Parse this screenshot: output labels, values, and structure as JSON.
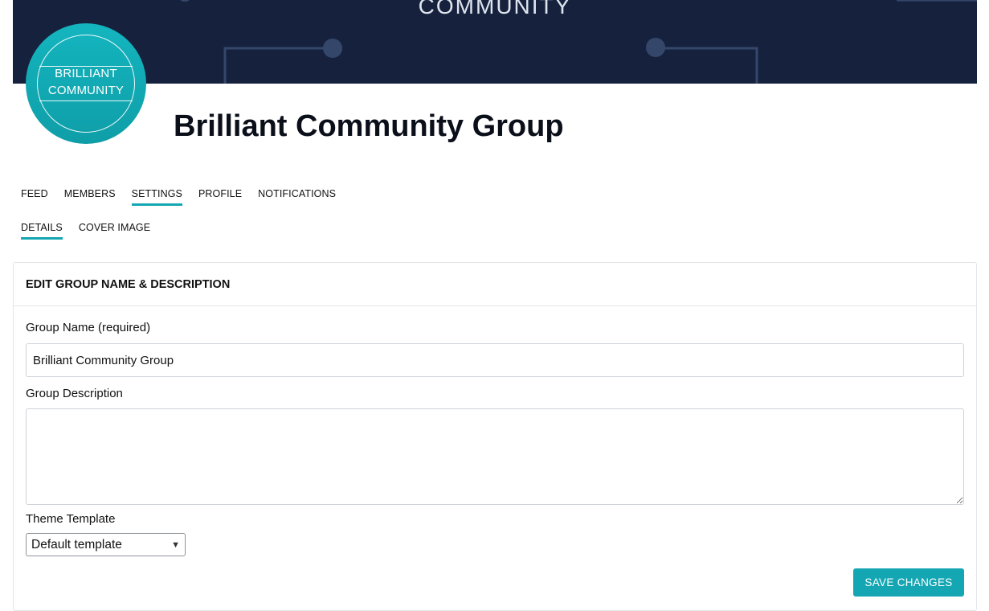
{
  "cover": {
    "text": "COMMUNITY",
    "background_color": "#16223d"
  },
  "avatar": {
    "line1": "BRILLIANT",
    "line2": "COMMUNITY",
    "color": "#14b5bf"
  },
  "group": {
    "title": "Brilliant Community Group"
  },
  "tabs": [
    {
      "label": "FEED",
      "active": false
    },
    {
      "label": "MEMBERS",
      "active": false
    },
    {
      "label": "SETTINGS",
      "active": true
    },
    {
      "label": "PROFILE",
      "active": false
    },
    {
      "label": "NOTIFICATIONS",
      "active": false
    }
  ],
  "subtabs": [
    {
      "label": "DETAILS",
      "active": true
    },
    {
      "label": "COVER IMAGE",
      "active": false
    }
  ],
  "panel": {
    "header": "EDIT GROUP NAME & DESCRIPTION",
    "name_label": "Group Name (required)",
    "name_value": "Brilliant Community Group",
    "description_label": "Group Description",
    "description_value": "",
    "theme_label": "Theme Template",
    "theme_selected": "Default template",
    "save_label": "SAVE CHANGES"
  },
  "colors": {
    "accent": "#14a7b3"
  }
}
